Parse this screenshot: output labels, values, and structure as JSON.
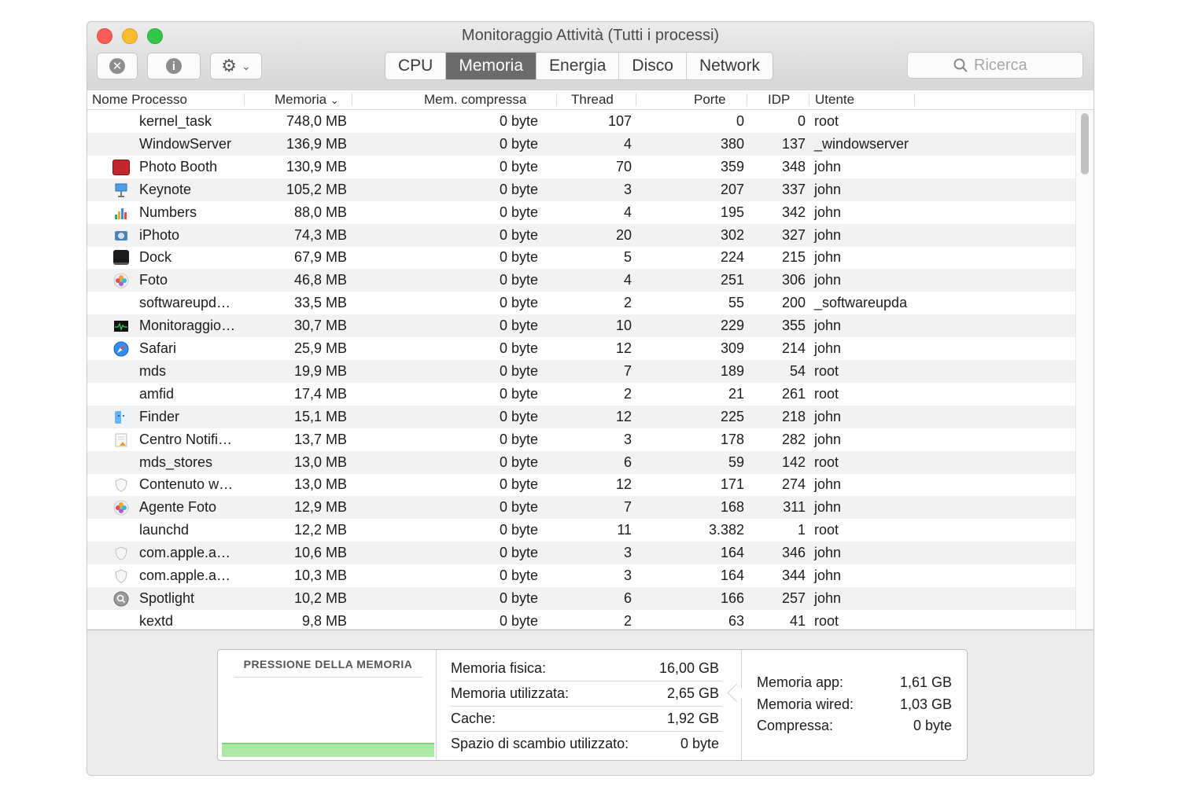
{
  "window": {
    "title": "Monitoraggio Attività (Tutti i processi)"
  },
  "tabs": [
    {
      "label": "CPU",
      "active": false
    },
    {
      "label": "Memoria",
      "active": true
    },
    {
      "label": "Energia",
      "active": false
    },
    {
      "label": "Disco",
      "active": false
    },
    {
      "label": "Network",
      "active": false
    }
  ],
  "search": {
    "placeholder": "Ricerca",
    "value": ""
  },
  "columns": {
    "name": "Nome Processo",
    "memory": "Memoria",
    "compressed": "Mem. compressa",
    "threads": "Thread",
    "ports": "Porte",
    "pid": "IDP",
    "user": "Utente"
  },
  "rows": [
    {
      "name": "kernel_task",
      "icon": "none",
      "memory": "748,0 MB",
      "compressed": "0 byte",
      "threads": "107",
      "ports": "0",
      "pid": "0",
      "user": "root"
    },
    {
      "name": "WindowServer",
      "icon": "none",
      "memory": "136,9 MB",
      "compressed": "0 byte",
      "threads": "4",
      "ports": "380",
      "pid": "137",
      "user": "_windowserver"
    },
    {
      "name": "Photo Booth",
      "icon": "photo-booth-icon",
      "memory": "130,9 MB",
      "compressed": "0 byte",
      "threads": "70",
      "ports": "359",
      "pid": "348",
      "user": "john"
    },
    {
      "name": "Keynote",
      "icon": "keynote-icon",
      "memory": "105,2 MB",
      "compressed": "0 byte",
      "threads": "3",
      "ports": "207",
      "pid": "337",
      "user": "john"
    },
    {
      "name": "Numbers",
      "icon": "numbers-icon",
      "memory": "88,0 MB",
      "compressed": "0 byte",
      "threads": "4",
      "ports": "195",
      "pid": "342",
      "user": "john"
    },
    {
      "name": "iPhoto",
      "icon": "iphoto-icon",
      "memory": "74,3 MB",
      "compressed": "0 byte",
      "threads": "20",
      "ports": "302",
      "pid": "327",
      "user": "john"
    },
    {
      "name": "Dock",
      "icon": "dock-icon",
      "memory": "67,9 MB",
      "compressed": "0 byte",
      "threads": "5",
      "ports": "224",
      "pid": "215",
      "user": "john"
    },
    {
      "name": "Foto",
      "icon": "photos-icon",
      "memory": "46,8 MB",
      "compressed": "0 byte",
      "threads": "4",
      "ports": "251",
      "pid": "306",
      "user": "john"
    },
    {
      "name": "softwareupd…",
      "icon": "none",
      "memory": "33,5 MB",
      "compressed": "0 byte",
      "threads": "2",
      "ports": "55",
      "pid": "200",
      "user": "_softwareupda"
    },
    {
      "name": "Monitoraggio…",
      "icon": "activity-monitor-icon",
      "memory": "30,7 MB",
      "compressed": "0 byte",
      "threads": "10",
      "ports": "229",
      "pid": "355",
      "user": "john"
    },
    {
      "name": "Safari",
      "icon": "safari-icon",
      "memory": "25,9 MB",
      "compressed": "0 byte",
      "threads": "12",
      "ports": "309",
      "pid": "214",
      "user": "john"
    },
    {
      "name": "mds",
      "icon": "none",
      "memory": "19,9 MB",
      "compressed": "0 byte",
      "threads": "7",
      "ports": "189",
      "pid": "54",
      "user": "root"
    },
    {
      "name": "amfid",
      "icon": "none",
      "memory": "17,4 MB",
      "compressed": "0 byte",
      "threads": "2",
      "ports": "21",
      "pid": "261",
      "user": "root"
    },
    {
      "name": "Finder",
      "icon": "finder-icon",
      "memory": "15,1 MB",
      "compressed": "0 byte",
      "threads": "12",
      "ports": "225",
      "pid": "218",
      "user": "john"
    },
    {
      "name": "Centro Notifi…",
      "icon": "notification-center-icon",
      "memory": "13,7 MB",
      "compressed": "0 byte",
      "threads": "3",
      "ports": "178",
      "pid": "282",
      "user": "john"
    },
    {
      "name": "mds_stores",
      "icon": "none",
      "memory": "13,0 MB",
      "compressed": "0 byte",
      "threads": "6",
      "ports": "59",
      "pid": "142",
      "user": "root"
    },
    {
      "name": "Contenuto w…",
      "icon": "shield-icon",
      "memory": "13,0 MB",
      "compressed": "0 byte",
      "threads": "12",
      "ports": "171",
      "pid": "274",
      "user": "john"
    },
    {
      "name": "Agente Foto",
      "icon": "photos-icon",
      "memory": "12,9 MB",
      "compressed": "0 byte",
      "threads": "7",
      "ports": "168",
      "pid": "311",
      "user": "john"
    },
    {
      "name": "launchd",
      "icon": "none",
      "memory": "12,2 MB",
      "compressed": "0 byte",
      "threads": "11",
      "ports": "3.382",
      "pid": "1",
      "user": "root"
    },
    {
      "name": "com.apple.a…",
      "icon": "shield-icon",
      "memory": "10,6 MB",
      "compressed": "0 byte",
      "threads": "3",
      "ports": "164",
      "pid": "346",
      "user": "john"
    },
    {
      "name": "com.apple.a…",
      "icon": "shield-icon",
      "memory": "10,3 MB",
      "compressed": "0 byte",
      "threads": "3",
      "ports": "164",
      "pid": "344",
      "user": "john"
    },
    {
      "name": "Spotlight",
      "icon": "spotlight-icon",
      "memory": "10,2 MB",
      "compressed": "0 byte",
      "threads": "6",
      "ports": "166",
      "pid": "257",
      "user": "john"
    },
    {
      "name": "kextd",
      "icon": "none",
      "memory": "9,8 MB",
      "compressed": "0 byte",
      "threads": "2",
      "ports": "63",
      "pid": "41",
      "user": "root"
    }
  ],
  "pressure": {
    "title": "PRESSIONE DELLA MEMORIA",
    "color": "#aee8a9"
  },
  "stats": [
    {
      "label": "Memoria fisica:",
      "value": "16,00 GB"
    },
    {
      "label": "Memoria utilizzata:",
      "value": "2,65 GB"
    },
    {
      "label": "Cache:",
      "value": "1,92 GB"
    },
    {
      "label": "Spazio di scambio utilizzato:",
      "value": "0 byte"
    }
  ],
  "memory_breakdown": [
    {
      "label": "Memoria app:",
      "value": "1,61 GB"
    },
    {
      "label": "Memoria wired:",
      "value": "1,03 GB"
    },
    {
      "label": "Compressa:",
      "value": "0 byte"
    }
  ],
  "colors": {
    "active_tab": "#6b6b6b",
    "alt_row": "#f2f2f2",
    "close": "#fc5e57",
    "minimize": "#fdbc2e",
    "zoom": "#33c748"
  }
}
